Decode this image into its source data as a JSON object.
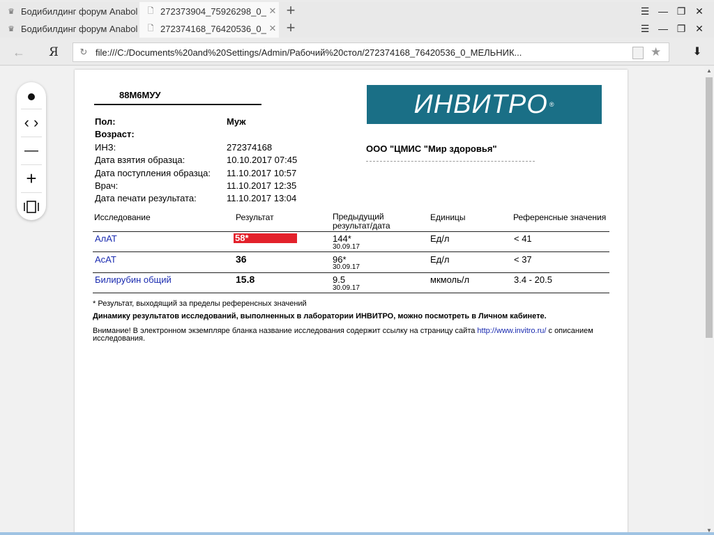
{
  "browser": {
    "tabs_row1": {
      "inactive_title": "Бодибилдинг форум Anaboli",
      "active_title": "272373904_75926298_0_",
      "close": "✕",
      "new_tab": "+"
    },
    "tabs_row2": {
      "inactive_title": "Бодибилдинг форум Anaboli",
      "active_title": "272374168_76420536_0_",
      "close": "✕",
      "new_tab": "+"
    },
    "window_controls": [
      "☰",
      "—",
      "❐",
      "✕"
    ],
    "nav_back": "←",
    "yandex_logo": "Я",
    "url": "file:///C:/Documents%20and%20Settings/Admin/Рабочий%20стол/272374168_76420536_0_МЕЛЬНИК...",
    "download": "⬇"
  },
  "zoom": {
    "prev_next": "‹ ›",
    "minus": "—",
    "plus": "+"
  },
  "document": {
    "code": "88М6МУУ",
    "fields": [
      {
        "label": "Пол:",
        "value": "Муж",
        "bold": true
      },
      {
        "label": "Возраст:",
        "value": "",
        "bold": true
      },
      {
        "label": "ИНЗ:",
        "value": "272374168"
      },
      {
        "label": "Дата взятия образца:",
        "value": "10.10.2017 07:45"
      },
      {
        "label": "Дата поступления образца:",
        "value": "11.10.2017 10:57"
      },
      {
        "label": "Врач:",
        "value": "11.10.2017 12:35"
      },
      {
        "label": "Дата печати результата:",
        "value": "11.10.2017 13:04"
      }
    ],
    "logo_text": "ИНВИТРО",
    "logo_mark": "®",
    "org_name": "ООО \"ЦМИС \"Мир здоровья\"",
    "table": {
      "headers": [
        "Исследование",
        "Результат",
        "Предыдущий результат/дата",
        "Единицы",
        "Референсные значения"
      ],
      "rows": [
        {
          "test": "АлАТ",
          "result": "58*",
          "flag": true,
          "prev": "144*",
          "prev_date": "30.09.17",
          "units": "Ед/л",
          "ref": "< 41"
        },
        {
          "test": "АсАТ",
          "result": "36",
          "flag": false,
          "prev": "96*",
          "prev_date": "30.09.17",
          "units": "Ед/л",
          "ref": "< 37"
        },
        {
          "test": "Билирубин общий",
          "result": "15.8",
          "flag": false,
          "prev": "9.5",
          "prev_date": "30.09.17",
          "units": "мкмоль/л",
          "ref": "3.4 - 20.5"
        }
      ]
    },
    "footnote": "* Результат, выходящий за пределы референсных значений",
    "dynamics_note": "Динамику результатов исследований, выполненных в лаборатории ИНВИТРО, можно посмотреть в Личном кабинете.",
    "attention_prefix": "Внимание! В электронном экземпляре бланка название исследования содержит ссылку на страницу сайта ",
    "attention_link": "http://www.invitro.ru/",
    "attention_suffix": " с описанием",
    "attention_line2": "исследования.",
    "accent_color": "#1a6f86",
    "flag_color": "#e3212b"
  }
}
